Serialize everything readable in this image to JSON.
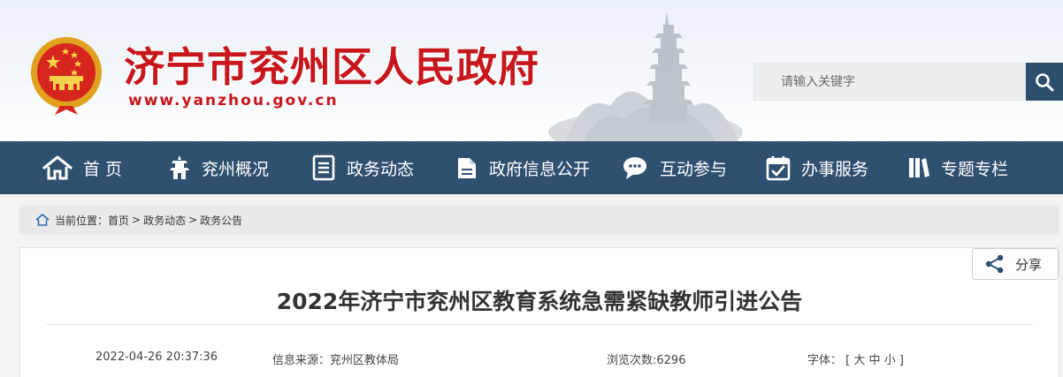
{
  "header": {
    "site_title": "济宁市兖州区人民政府",
    "site_url": "www.yanzhou.gov.cn",
    "search_placeholder": "请输入关键字",
    "colors": {
      "title_red": "#c8161d",
      "nav_blue": "#30506f",
      "search_button": "#2e4e6e"
    }
  },
  "nav": {
    "items": [
      {
        "label": "首 页",
        "icon": "home-icon"
      },
      {
        "label": "兖州概况",
        "icon": "pagoda-icon"
      },
      {
        "label": "政务动态",
        "icon": "document-list-icon"
      },
      {
        "label": "政府信息公开",
        "icon": "folder-open-icon"
      },
      {
        "label": "互动参与",
        "icon": "chat-icon"
      },
      {
        "label": "办事服务",
        "icon": "calendar-check-icon"
      },
      {
        "label": "专题专栏",
        "icon": "book-icon"
      }
    ]
  },
  "breadcrumb": {
    "prefix": "当前位置：",
    "items": [
      "首页",
      "政务动态",
      "政务公告"
    ],
    "separator": ">"
  },
  "article": {
    "share_label": "分享",
    "title": "2022年济宁市兖州区教育系统急需紧缺教师引进公告",
    "date": "2022-04-26 20:37:36",
    "source": "信息来源：兖州区教体局",
    "views": "浏览次数:6296",
    "font_label": "字体：",
    "font_open": "[",
    "font_sizes": [
      "大",
      "中",
      "小"
    ],
    "font_close": "]"
  }
}
